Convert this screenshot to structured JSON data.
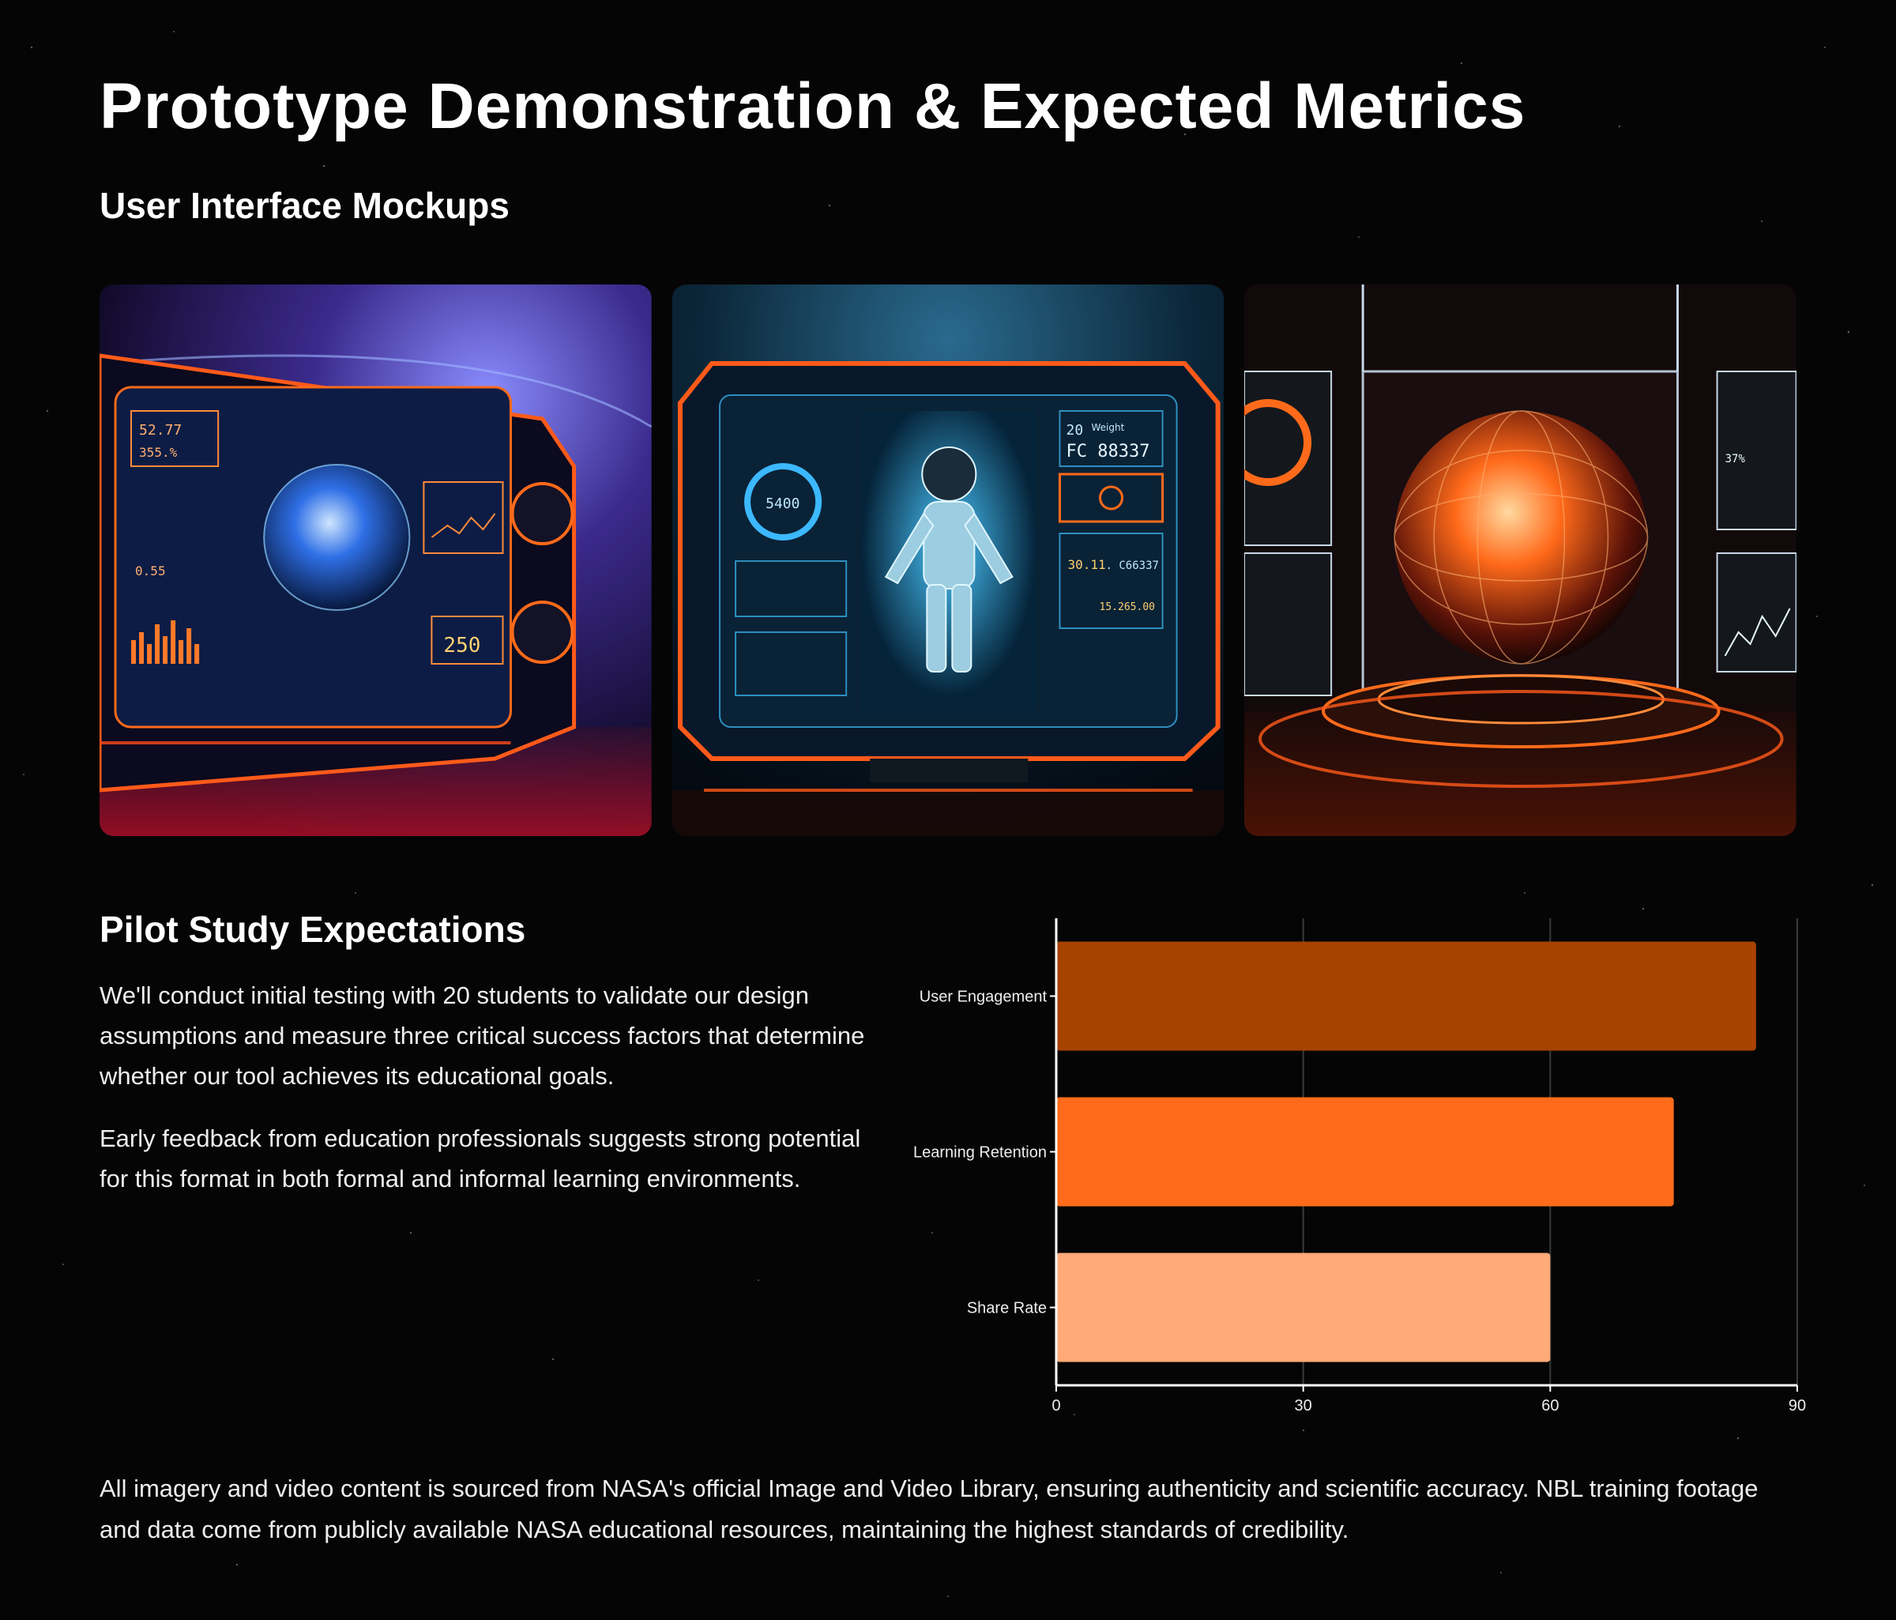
{
  "page": {
    "title": "Prototype Demonstration & Expected Metrics",
    "mockups_heading": "User Interface Mockups",
    "mockups": [
      {
        "name": "mockup-earth-dashboard",
        "readouts": [
          "52.77",
          "355.%",
          "0.55",
          "250"
        ]
      },
      {
        "name": "mockup-astronaut-console",
        "readouts": [
          "20",
          "Weight",
          "FC 88337",
          "5400",
          "30.11",
          ". C66337",
          "15.265.00"
        ]
      },
      {
        "name": "mockup-hologram-globe",
        "readouts": [
          "37%"
        ]
      }
    ],
    "pilot": {
      "heading": "Pilot Study Expectations",
      "paragraphs": [
        "We'll conduct initial testing with 20 students to validate our design assumptions and measure three critical success factors that determine whether our tool achieves its educational goals.",
        "Early feedback from education professionals suggests strong potential for this format in both formal and informal learning environments."
      ]
    },
    "footer_note": "All imagery and video content is sourced from NASA's official Image and Video Library, ensuring authenticity and scientific accuracy. NBL training footage and data come from publicly available NASA educational resources, maintaining the highest standards of credibility."
  },
  "colors": {
    "background": "#050505",
    "accent_dark_orange": "#A84200",
    "accent_orange": "#FF6B1A",
    "accent_peach": "#FFAA78",
    "text_primary": "#ffffff",
    "text_secondary": "#eeeeee"
  },
  "chart_data": {
    "type": "bar",
    "orientation": "horizontal",
    "categories": [
      "User Engagement",
      "Learning Retention",
      "Share Rate"
    ],
    "values": [
      85,
      75,
      60
    ],
    "bar_colors": [
      "#A84200",
      "#FF6B1A",
      "#FFAA78"
    ],
    "xlim": [
      0,
      90
    ],
    "xticks": [
      0,
      30,
      60,
      90
    ],
    "grid": true,
    "legend": false,
    "title": "",
    "xlabel": "",
    "ylabel": ""
  }
}
